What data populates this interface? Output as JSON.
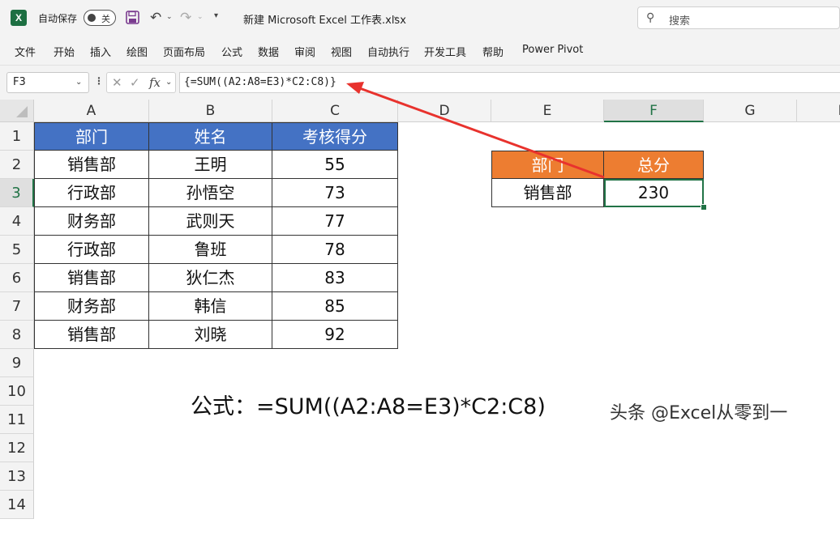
{
  "window": {
    "app_logo": "X",
    "autosave_label": "自动保存",
    "autosave_state": "关",
    "document_title": "新建 Microsoft Excel 工作表.xlsx",
    "search_placeholder": "搜索"
  },
  "ribbon": {
    "tabs": [
      "文件",
      "开始",
      "插入",
      "绘图",
      "页面布局",
      "公式",
      "数据",
      "审阅",
      "视图",
      "自动执行",
      "开发工具",
      "帮助",
      "Power Pivot"
    ]
  },
  "formula_bar": {
    "name_box": "F3",
    "formula": "{=SUM((A2:A8=E3)*C2:C8)}"
  },
  "sheet": {
    "columns": [
      "A",
      "B",
      "C",
      "D",
      "E",
      "F",
      "G",
      "H"
    ],
    "rows": [
      "1",
      "2",
      "3",
      "4",
      "5",
      "6",
      "7",
      "8",
      "9",
      "10",
      "11",
      "12",
      "13",
      "14"
    ],
    "selected_column": "F",
    "selected_row": "3",
    "table_headers": [
      "部门",
      "姓名",
      "考核得分"
    ],
    "table_rows": [
      [
        "销售部",
        "王明",
        "55"
      ],
      [
        "行政部",
        "孙悟空",
        "73"
      ],
      [
        "财务部",
        "武则天",
        "77"
      ],
      [
        "行政部",
        "鲁班",
        "78"
      ],
      [
        "销售部",
        "狄仁杰",
        "83"
      ],
      [
        "财务部",
        "韩信",
        "85"
      ],
      [
        "销售部",
        "刘晓",
        "92"
      ]
    ],
    "summary_headers": [
      "部门",
      "总分"
    ],
    "summary_values": [
      "销售部",
      "230"
    ],
    "note": "公式：=SUM((A2:A8=E3)*C2:C8)"
  },
  "watermark": "头条 @Excel从零到一",
  "colors": {
    "table_header_bg": "#4472c4",
    "summary_header_bg": "#ed7d31",
    "selection": "#217346",
    "arrow": "#e8322d"
  }
}
